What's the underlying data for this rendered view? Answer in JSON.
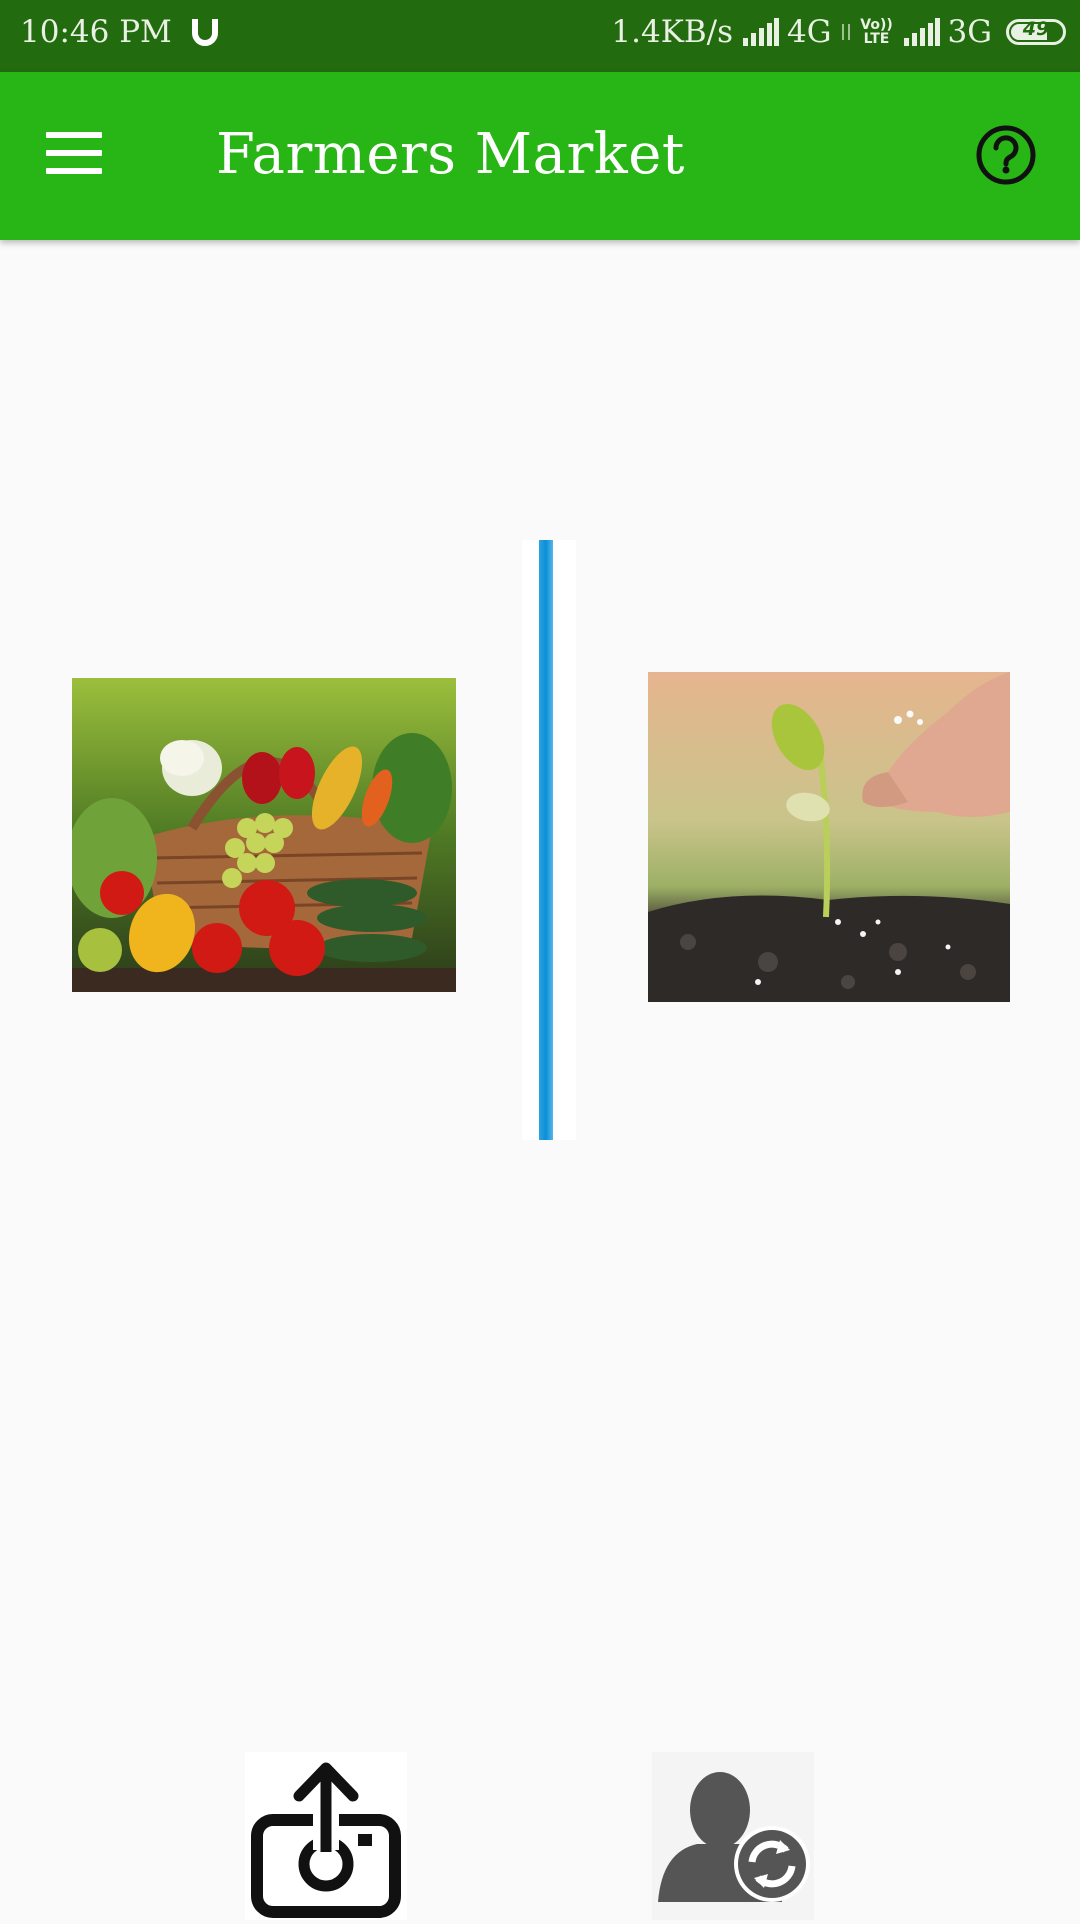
{
  "status_bar": {
    "time": "10:46 PM",
    "net_speed": "1.4KB/s",
    "net1": "4G",
    "volte": "Vo)) LTE",
    "net2": "3G",
    "battery": "49"
  },
  "app_bar": {
    "title": "Farmers Market",
    "menu_icon": "hamburger-menu-icon",
    "help_icon": "help-circle-icon",
    "color": "#28b516"
  },
  "main": {
    "options": [
      {
        "icon": "vegetable-basket-image"
      },
      {
        "icon": "seedling-image"
      }
    ],
    "divider_color": "#0a8fd6"
  },
  "bottom_bar": {
    "buttons": [
      {
        "icon": "upload-photo-icon"
      },
      {
        "icon": "switch-user-icon"
      }
    ]
  }
}
